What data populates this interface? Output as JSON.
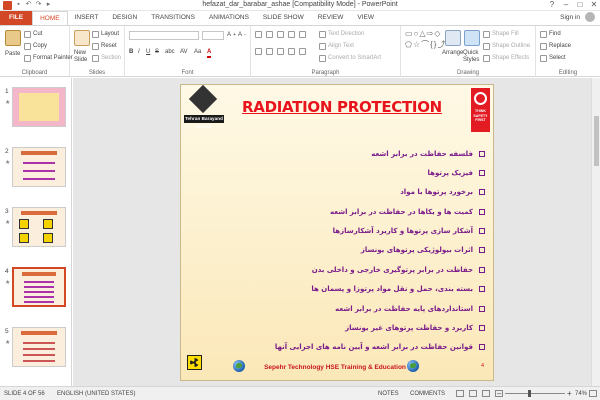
{
  "window": {
    "title": "hefazat_dar_barabar_ashae [Compatibility Mode] - PowerPoint",
    "controls": [
      "?",
      "–",
      "□",
      "✕"
    ]
  },
  "ribbon_tabs": [
    "FILE",
    "HOME",
    "INSERT",
    "DESIGN",
    "TRANSITIONS",
    "ANIMATIONS",
    "SLIDE SHOW",
    "REVIEW",
    "VIEW"
  ],
  "active_tab": "HOME",
  "sign_in": "Sign in",
  "ribbon": {
    "clipboard": {
      "paste": "Paste",
      "cut": "Cut",
      "copy": "Copy",
      "format_painter": "Format Painter",
      "label": "Clipboard"
    },
    "slides": {
      "new_slide": "New",
      "new_slide_2": "Slide",
      "layout": "Layout",
      "reset": "Reset",
      "section": "Section",
      "label": "Slides"
    },
    "font": {
      "label": "Font",
      "bold": "B",
      "italic": "I",
      "underline": "U",
      "strike": "S",
      "shadow": "abc",
      "spacing": "AV",
      "case": "Aa",
      "color": "A"
    },
    "paragraph": {
      "text_direction": "Text Direction",
      "align_text": "Align Text",
      "smartart": "Convert to SmartArt",
      "label": "Paragraph"
    },
    "drawing": {
      "arrange": "Arrange",
      "quick_styles": "Quick",
      "quick_styles_2": "Styles",
      "shape_fill": "Shape Fill",
      "shape_outline": "Shape Outline",
      "shape_effects": "Shape Effects",
      "label": "Drawing"
    },
    "editing": {
      "find": "Find",
      "replace": "Replace",
      "select": "Select",
      "label": "Editing"
    }
  },
  "thumbnails": [
    {
      "num": "1",
      "star": "★"
    },
    {
      "num": "2",
      "star": "★"
    },
    {
      "num": "3",
      "star": "★"
    },
    {
      "num": "4",
      "star": "★"
    },
    {
      "num": "5",
      "star": "★"
    }
  ],
  "selected_slide": 4,
  "slide": {
    "title": "RADIATION PROTECTION",
    "left_logo_caption": "Tehran Barayand Sepehr",
    "right_logo_text": "THINK SAFETY FIRST",
    "bullets": [
      "فلسفه حفاظت در برابر اشعه",
      "فیزیک پرتوها",
      "برخورد پرتوها با مواد",
      "کمیت ها و یکاها در حفاظت در برابر اشعه",
      "آشکار سازی پرتوها و کاربرد آشکارسازها",
      "اثرات بیولوژیکی پرتوهای یونساز",
      "حفاظت در برابر پرتوگیری خارجی و داخلی بدن",
      "بسته بندی، حمل و نقل مواد پرتوزا و پسمان ها",
      "استانداردهای پایه حفاظت در برابر اشعه",
      "کاربرد و حفاظت پرتوهای غیر یونساز",
      "قوانین حفاظت در برابر اشعه و آیین نامه های اجرایی آنها"
    ],
    "footer": "Sepehr Technology HSE Training & Education",
    "page_number": "4"
  },
  "status": {
    "slide_of": "SLIDE 4 OF 56",
    "language": "ENGLISH (UNITED STATES)",
    "notes": "NOTES",
    "comments": "COMMENTS",
    "zoom_minus": "–",
    "zoom_plus": "+",
    "zoom": "74%",
    "zoom_level_percent": 74
  },
  "colors": {
    "accent": "#d24726",
    "slide_title": "#e8141d",
    "bullet_text": "#7a1a8a",
    "slide_bg": "#fdf5dd"
  }
}
